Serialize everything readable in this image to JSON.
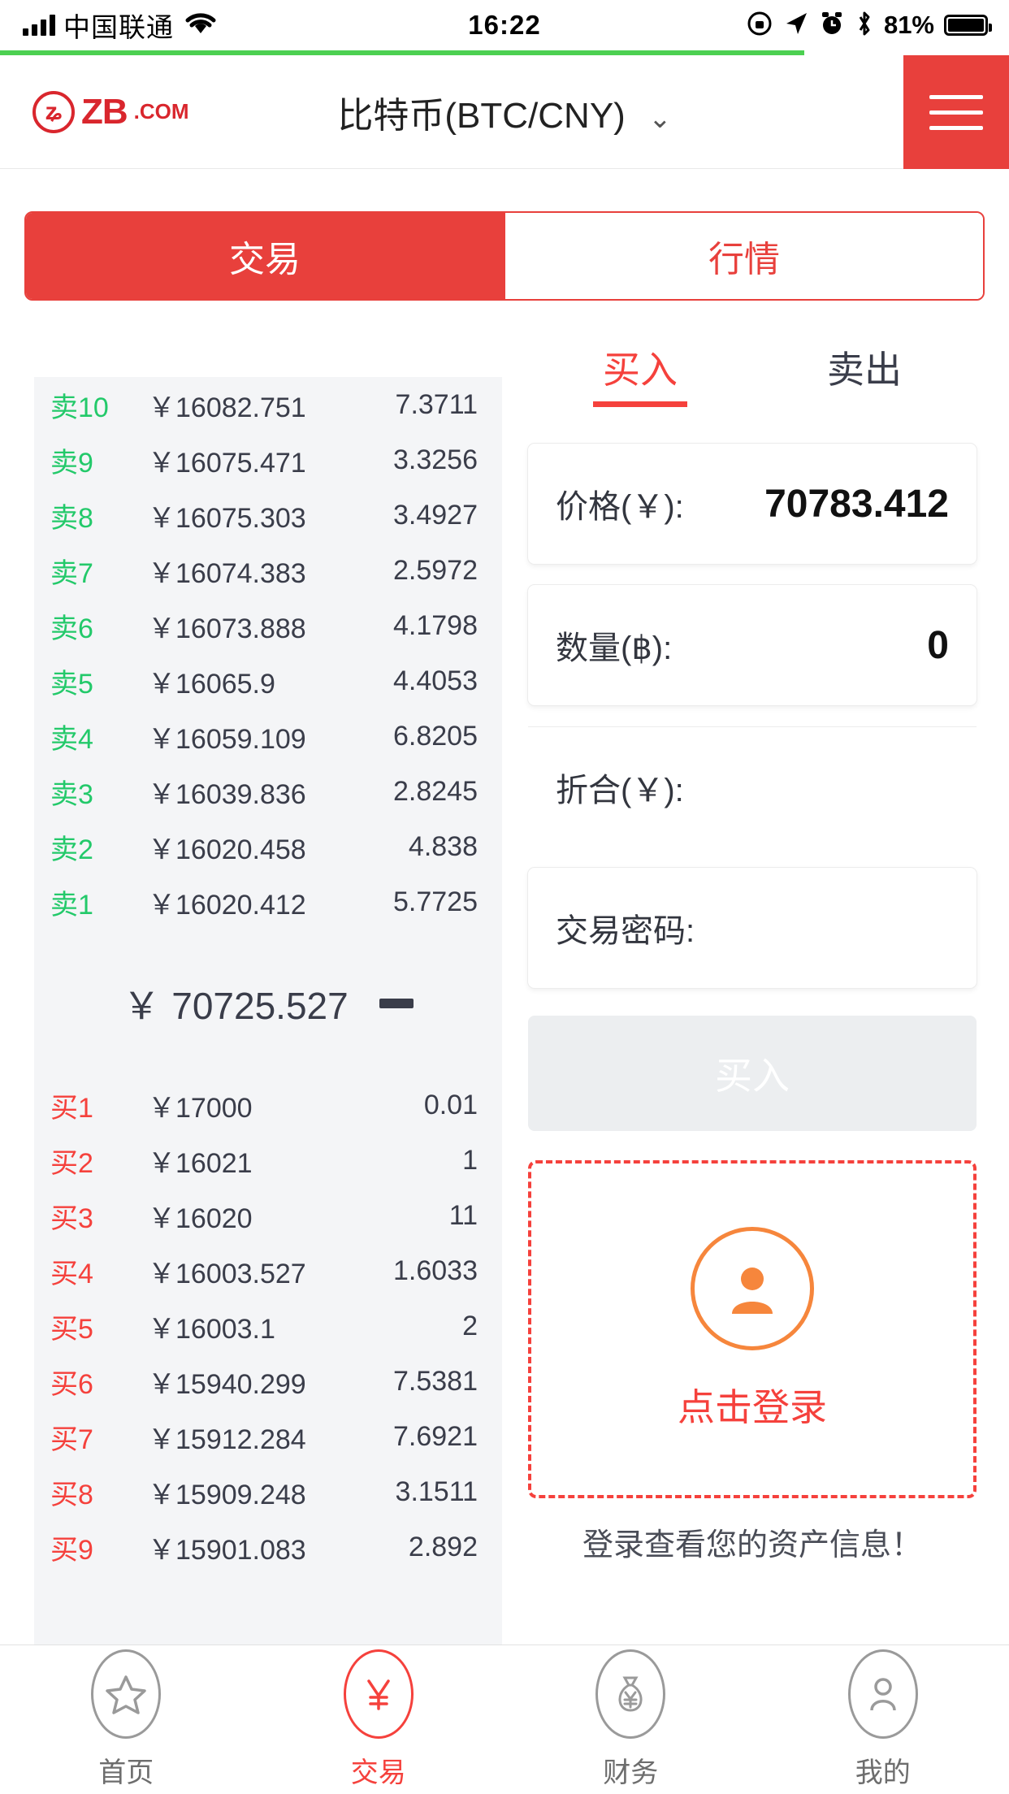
{
  "status_bar": {
    "carrier": "中国联通",
    "time": "16:22",
    "battery_pct": "81%",
    "icons": [
      "signal-bars-icon",
      "wifi-icon",
      "rotation-lock-icon",
      "location-arrow-icon",
      "alarm-clock-icon",
      "bluetooth-icon",
      "battery-icon"
    ]
  },
  "header": {
    "logo_text": "ZB",
    "logo_suffix": ".COM",
    "logo_glyph": "ʑ",
    "pair_title": "比特币(BTC/CNY)",
    "chevron": "⌄",
    "menu_icon": "hamburger-menu-icon"
  },
  "main_tabs": [
    {
      "label": "交易",
      "active": true
    },
    {
      "label": "行情",
      "active": false
    }
  ],
  "order_book": {
    "sell_orders": [
      {
        "tag": "卖10",
        "price": "￥16082.751",
        "amount": "7.3711"
      },
      {
        "tag": "卖9",
        "price": "￥16075.471",
        "amount": "3.3256"
      },
      {
        "tag": "卖8",
        "price": "￥16075.303",
        "amount": "3.4927"
      },
      {
        "tag": "卖7",
        "price": "￥16074.383",
        "amount": "2.5972"
      },
      {
        "tag": "卖6",
        "price": "￥16073.888",
        "amount": "4.1798"
      },
      {
        "tag": "卖5",
        "price": "￥16065.9",
        "amount": "4.4053"
      },
      {
        "tag": "卖4",
        "price": "￥16059.109",
        "amount": "6.8205"
      },
      {
        "tag": "卖3",
        "price": "￥16039.836",
        "amount": "2.8245"
      },
      {
        "tag": "卖2",
        "price": "￥16020.458",
        "amount": "4.838"
      },
      {
        "tag": "卖1",
        "price": "￥16020.412",
        "amount": "5.7725"
      }
    ],
    "mid": {
      "currency": "￥",
      "price": "70725.527",
      "trend": "flat"
    },
    "buy_orders": [
      {
        "tag": "买1",
        "price": "￥17000",
        "amount": "0.01"
      },
      {
        "tag": "买2",
        "price": "￥16021",
        "amount": "1"
      },
      {
        "tag": "买3",
        "price": "￥16020",
        "amount": "11"
      },
      {
        "tag": "买4",
        "price": "￥16003.527",
        "amount": "1.6033"
      },
      {
        "tag": "买5",
        "price": "￥16003.1",
        "amount": "2"
      },
      {
        "tag": "买6",
        "price": "￥15940.299",
        "amount": "7.5381"
      },
      {
        "tag": "买7",
        "price": "￥15912.284",
        "amount": "7.6921"
      },
      {
        "tag": "买8",
        "price": "￥15909.248",
        "amount": "3.1511"
      },
      {
        "tag": "买9",
        "price": "￥15901.083",
        "amount": "2.892"
      }
    ]
  },
  "trade_form": {
    "side_tabs": [
      {
        "label": "买入",
        "active": true
      },
      {
        "label": "卖出",
        "active": false
      }
    ],
    "price_label": "价格(￥):",
    "price_value": "70783.412",
    "amount_label": "数量(฿):",
    "amount_value": "0",
    "total_label": "折合(￥):",
    "total_value": "",
    "password_label": "交易密码:",
    "password_value": "",
    "submit_label": "买入"
  },
  "login_panel": {
    "avatar_icon": "user-avatar-icon",
    "cta_label": "点击登录",
    "hint": "登录查看您的资产信息！"
  },
  "bottom_nav": [
    {
      "label": "首页",
      "icon": "star-icon",
      "active": false
    },
    {
      "label": "交易",
      "icon": "yuan-trade-icon",
      "active": true
    },
    {
      "label": "财务",
      "icon": "money-bag-icon",
      "active": false
    },
    {
      "label": "我的",
      "icon": "person-icon",
      "active": false
    }
  ],
  "colors": {
    "brand_red": "#e8403c",
    "accent_red": "#f5413c",
    "sell_green": "#23c96a",
    "loadbar_green": "#4cd051",
    "orange": "#f6863c",
    "panel_bg": "#f4f5f7"
  }
}
